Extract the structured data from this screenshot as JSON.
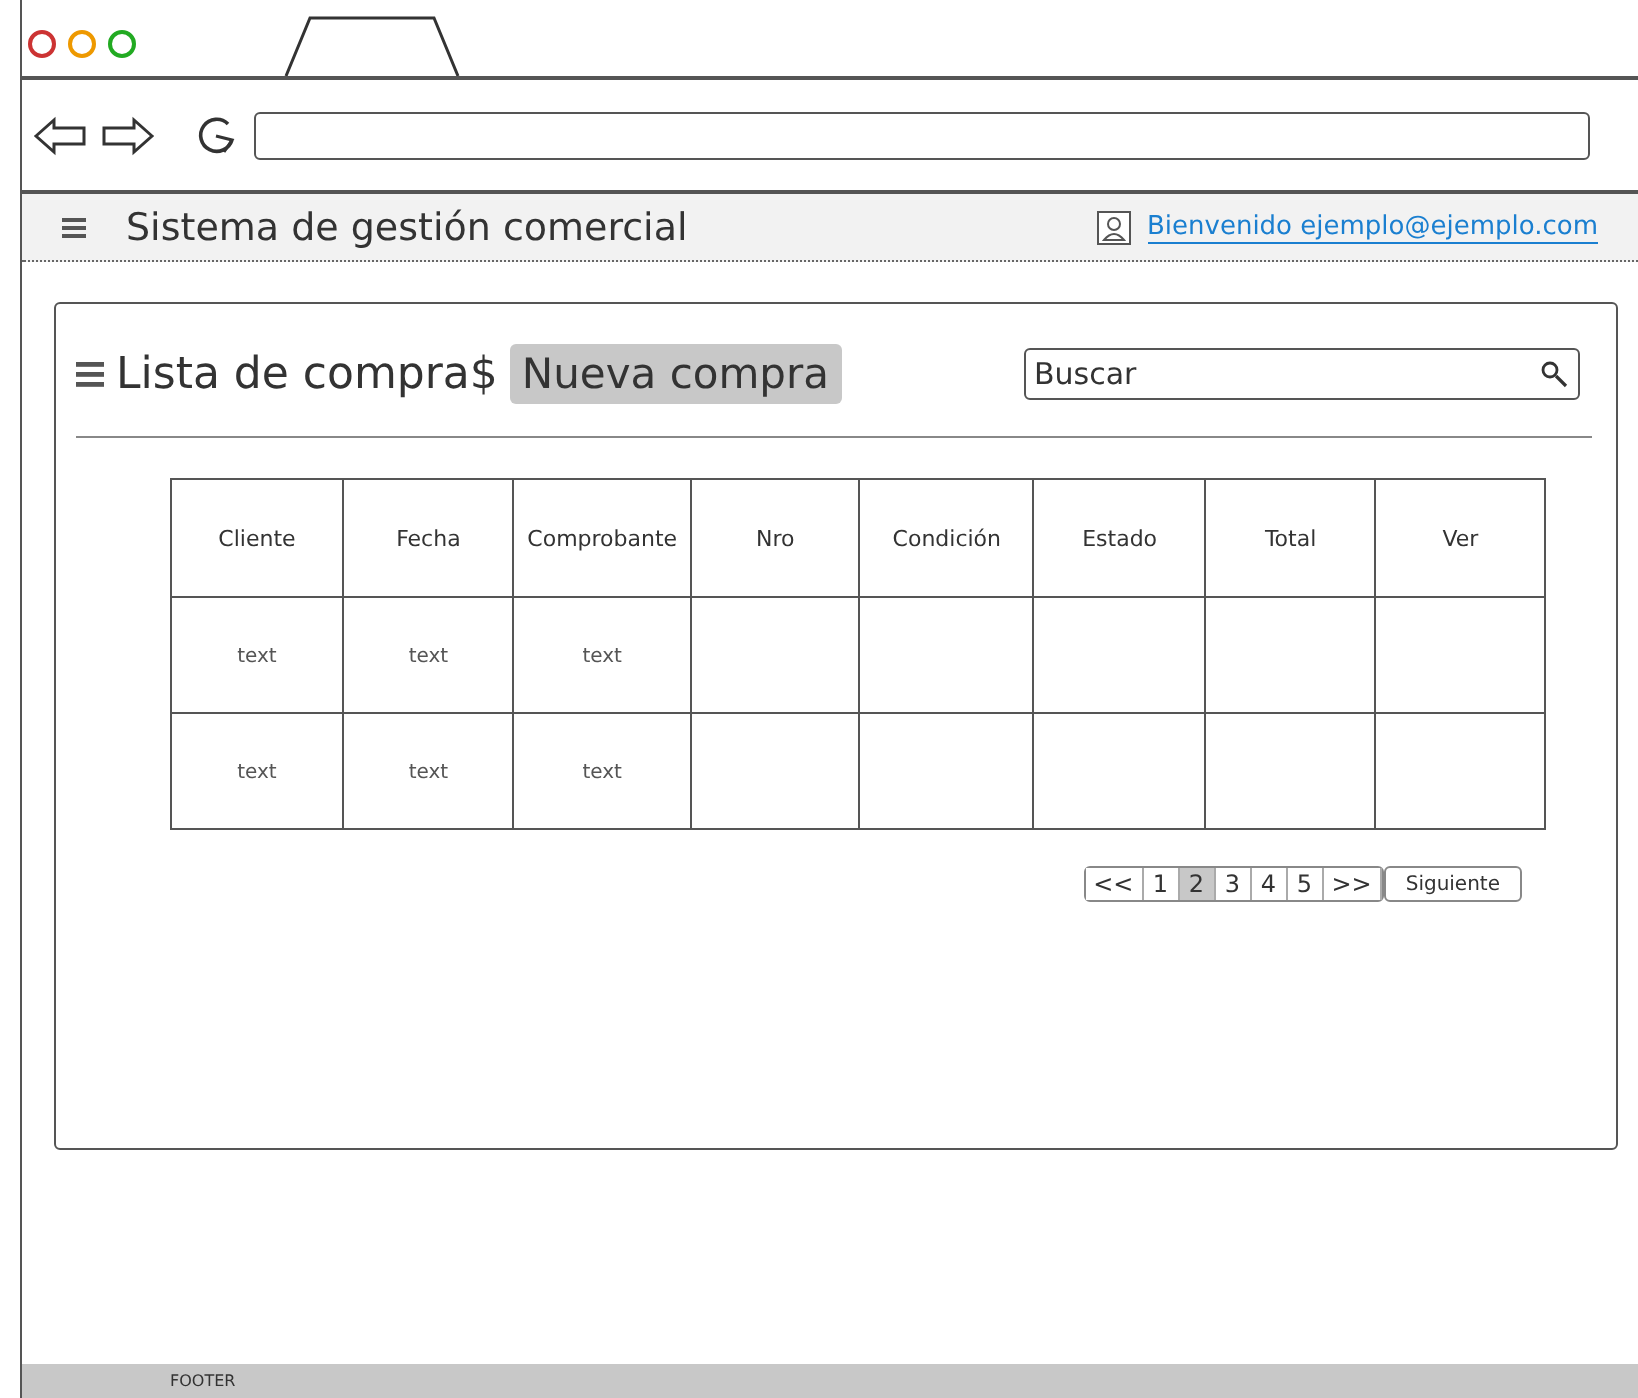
{
  "header": {
    "title": "Sistema de gestión comercial",
    "user_link": "Bienvenido ejemplo@ejemplo.com"
  },
  "card": {
    "title": "Lista de compra$",
    "new_button": "Nueva compra",
    "search": {
      "placeholder": "Buscar"
    }
  },
  "table": {
    "columns": [
      "Cliente",
      "Fecha",
      "Comprobante",
      "Nro",
      "Condición",
      "Estado",
      "Total",
      "Ver"
    ],
    "rows": [
      {
        "cells": [
          "text",
          "text",
          "text"
        ]
      },
      {
        "cells": [
          "text",
          "text",
          "text"
        ]
      }
    ]
  },
  "pagination": {
    "pages": [
      {
        "label": "<<",
        "selected": false
      },
      {
        "label": "1",
        "selected": false
      },
      {
        "label": "2",
        "selected": true
      },
      {
        "label": "3",
        "selected": false
      },
      {
        "label": "4",
        "selected": false
      },
      {
        "label": "5",
        "selected": false
      },
      {
        "label": ">>",
        "selected": false
      }
    ],
    "next": "Siguiente"
  },
  "footer": {
    "text": "FOOTER"
  }
}
